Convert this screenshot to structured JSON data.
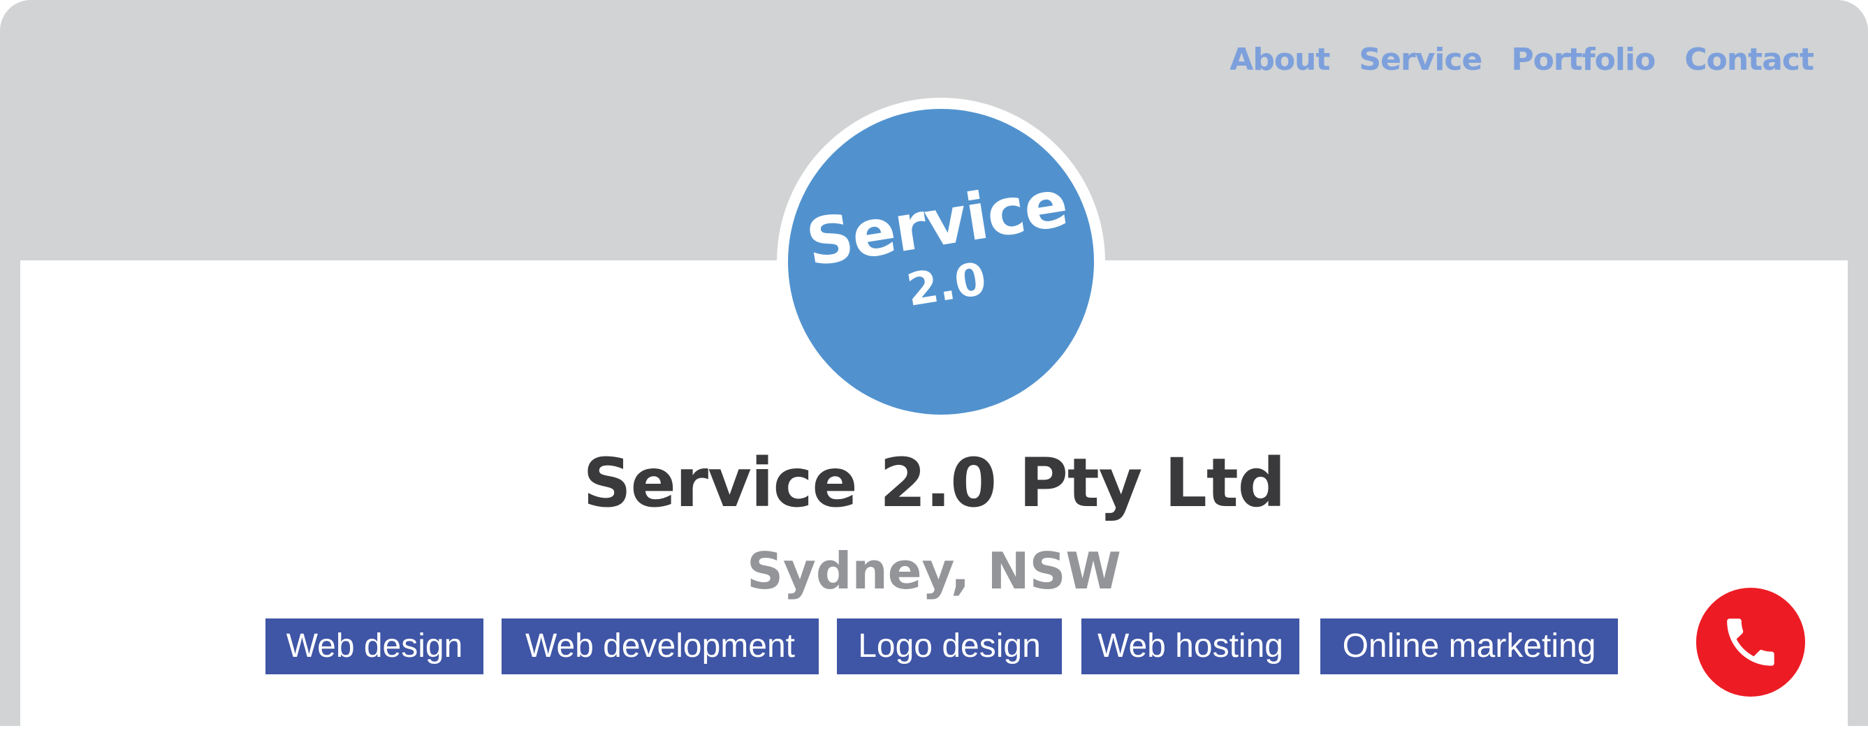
{
  "nav": {
    "items": [
      {
        "label": "About"
      },
      {
        "label": "Service"
      },
      {
        "label": "Portfolio"
      },
      {
        "label": "Contact"
      }
    ]
  },
  "logo": {
    "word": "Service",
    "version": "2.0"
  },
  "profile": {
    "company_name": "Service 2.0 Pty Ltd",
    "location": "Sydney, NSW"
  },
  "tags": [
    {
      "label": "Web design"
    },
    {
      "label": "Web development"
    },
    {
      "label": "Logo design"
    },
    {
      "label": "Web hosting"
    },
    {
      "label": "Online marketing"
    }
  ],
  "call_button": {
    "icon": "phone-icon"
  },
  "colors": {
    "header_background": "#d1d3d4",
    "nav_link": "#7da0dc",
    "logo_circle": "#5192ce",
    "tag_background": "#3f55a5",
    "call_button": "#ed1c24",
    "company_name": "#3a3a3c",
    "location": "#939598"
  }
}
